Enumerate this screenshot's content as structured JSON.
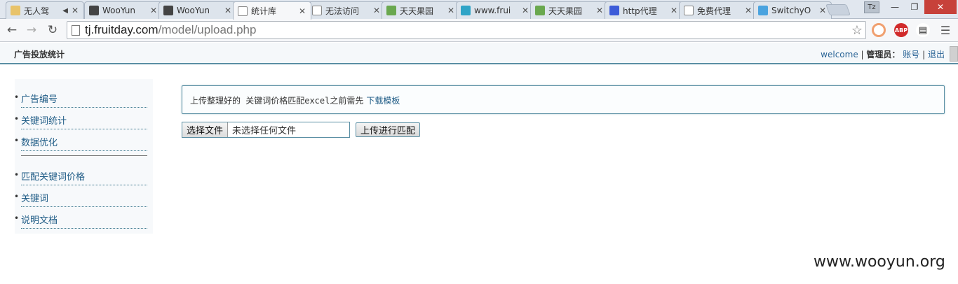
{
  "browser": {
    "tabs": [
      {
        "title": "无人驾",
        "icon": "app-icon",
        "color": "#e8c36a",
        "muted": true
      },
      {
        "title": "WooYun",
        "icon": "wooyun-icon",
        "color": "#444444"
      },
      {
        "title": "WooYun",
        "icon": "wooyun-icon",
        "color": "#444444"
      },
      {
        "title": "统计库",
        "icon": "page-icon",
        "color": "#ffffff",
        "active": true
      },
      {
        "title": "无法访问",
        "icon": "page-icon",
        "color": "#ffffff"
      },
      {
        "title": "天天果园",
        "icon": "grid-icon",
        "color": "#6aa84f"
      },
      {
        "title": "www.frui",
        "icon": "fruit-icon",
        "color": "#2fa4c7"
      },
      {
        "title": "天天果园",
        "icon": "grid-icon",
        "color": "#6aa84f"
      },
      {
        "title": "http代理",
        "icon": "paw-icon",
        "color": "#3c5bd8"
      },
      {
        "title": "免费代理",
        "icon": "page-icon",
        "color": "#ffffff"
      },
      {
        "title": "SwitchyO",
        "icon": "circle-icon",
        "color": "#4aa3df"
      }
    ],
    "profile_label": "Tz",
    "url_host": "tj.fruitday.com",
    "url_path": "/model/upload.php",
    "extensions": {
      "abp_label": "ABP"
    }
  },
  "site": {
    "title": "广告投放统计",
    "welcome": "welcome",
    "sep1": "|",
    "role": "管理员：",
    "account": "账号",
    "sep2": "|",
    "logout": "退出"
  },
  "sidebar": {
    "items": [
      {
        "label": "广告编号"
      },
      {
        "label": "关键词统计"
      },
      {
        "label": "数据优化"
      },
      {
        "label": "匹配关键词价格"
      },
      {
        "label": "关键词"
      },
      {
        "label": "说明文档"
      }
    ]
  },
  "main": {
    "notice_text": "上传整理好的 关键词价格匹配excel之前需先",
    "download_link": "下载模板",
    "file_button": "选择文件",
    "file_placeholder": "未选择任何文件",
    "upload_button": "上传进行匹配"
  },
  "watermark": "www.wooyun.org"
}
